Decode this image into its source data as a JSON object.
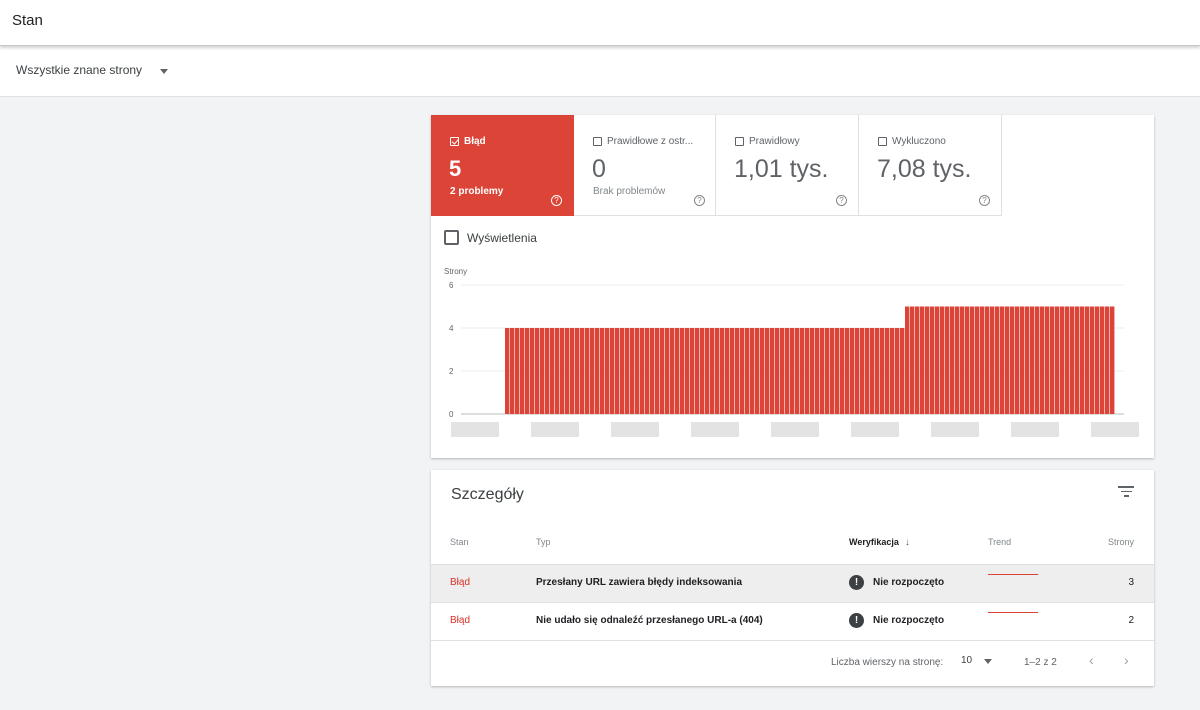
{
  "header": {
    "title": "Stan"
  },
  "filter": {
    "selected": "Wszystkie znane strony"
  },
  "tiles": [
    {
      "label": "Błąd",
      "value": "5",
      "sub": "2 problemy",
      "checked": true
    },
    {
      "label": "Prawidłowe z ostr...",
      "value": "0",
      "sub": "Brak problemów",
      "checked": false
    },
    {
      "label": "Prawidłowy",
      "value": "1,01 tys.",
      "sub": "",
      "checked": false
    },
    {
      "label": "Wykluczono",
      "value": "7,08 tys.",
      "sub": "",
      "checked": false
    }
  ],
  "help_glyph": "?",
  "impressions": {
    "label": "Wyświetlenia",
    "checked": false
  },
  "chart_data": {
    "type": "bar",
    "ylabel": "Strony",
    "ylim": [
      0,
      6
    ],
    "yticks": [
      0,
      2,
      4,
      6
    ],
    "series": [
      {
        "values": [
          4,
          4,
          4,
          4,
          4,
          4,
          4,
          4,
          4,
          4,
          4,
          4,
          4,
          4,
          4,
          4,
          4,
          4,
          4,
          4,
          4,
          4,
          4,
          4,
          4,
          4,
          4,
          4,
          4,
          4,
          4,
          4,
          4,
          4,
          4,
          4,
          4,
          4,
          4,
          4,
          4,
          4,
          4,
          4,
          4,
          4,
          4,
          4,
          4,
          4,
          4,
          4,
          4,
          4,
          4,
          4,
          4,
          4,
          4,
          4,
          4,
          4,
          4,
          4,
          4,
          4,
          4,
          4,
          4,
          4,
          4,
          4,
          4,
          4,
          4,
          4,
          4,
          4,
          4,
          4,
          5,
          5,
          5,
          5,
          5,
          5,
          5,
          5,
          5,
          5,
          5,
          5,
          5,
          5,
          5,
          5,
          5,
          5,
          5,
          5,
          5,
          5,
          5,
          5,
          5,
          5,
          5,
          5,
          5,
          5,
          5,
          5,
          5,
          5,
          5,
          5,
          5,
          5,
          5,
          5,
          5,
          5
        ]
      }
    ],
    "x_labels_obscured": true,
    "color": "#db4437"
  },
  "details": {
    "title": "Szczegóły",
    "columns": {
      "stan": "Stan",
      "typ": "Typ",
      "weryfikacja": "Weryfikacja",
      "sort_arrow": "↓",
      "trend": "Trend",
      "strony": "Strony"
    },
    "rows": [
      {
        "stan": "Błąd",
        "typ": "Przesłany URL zawiera błędy indeksowania",
        "weryfikacja": "Nie rozpoczęto",
        "strony": "3",
        "status_glyph": "!"
      },
      {
        "stan": "Błąd",
        "typ": "Nie udało się odnaleźć przesłanego URL-a (404)",
        "weryfikacja": "Nie rozpoczęto",
        "strony": "2",
        "status_glyph": "!"
      }
    ],
    "pagination": {
      "rows_label": "Liczba wierszy na stronę:",
      "rows_per_page": "10",
      "range": "1–2 z 2",
      "prev": "‹",
      "next": "›"
    }
  },
  "colors": {
    "error": "#db4437",
    "error_text": "#d93025"
  }
}
